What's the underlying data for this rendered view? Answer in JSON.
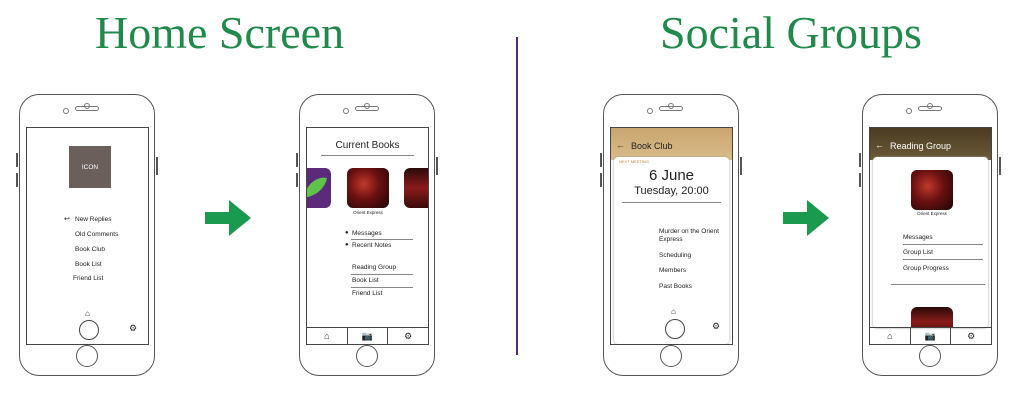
{
  "headings": {
    "home": "Home Screen",
    "social": "Social Groups"
  },
  "colors": {
    "heading_green": "#1f8a4c",
    "arrow_green": "#1a9a4e",
    "divider": "#5a2a6a",
    "book_club_header": "#c8a46e",
    "reading_group_header": "#5a4a2e",
    "icon_box": "#6b5f5c"
  },
  "screen1": {
    "icon_label": "ICON",
    "menu": [
      "New Replies",
      "Old Comments",
      "Book Club",
      "Book List",
      "Friend List"
    ]
  },
  "screen2": {
    "title": "Current Books",
    "book_caption": "Orient Express",
    "bullets": [
      "Messages",
      "Recent Notes"
    ],
    "groups": [
      "Reading Group",
      "Book List",
      "Friend List"
    ]
  },
  "screen3": {
    "title": "Book Club",
    "next_meeting_label": "NEXT MEETING",
    "date": "6 June",
    "day_time": "Tuesday, 20:00",
    "items": [
      "Murder on the Orient Express",
      "Scheduling",
      "Members",
      "Past Books"
    ]
  },
  "screen4": {
    "title": "Reading Group",
    "book_caption": "Orient Express",
    "menu": [
      "Messages",
      "Group List",
      "Group Progress"
    ]
  },
  "icons": {
    "home": "home-icon",
    "camera": "camera-icon",
    "settings": "gear-icon",
    "back": "arrow-left-icon",
    "arrow": "arrow-right-icon"
  }
}
